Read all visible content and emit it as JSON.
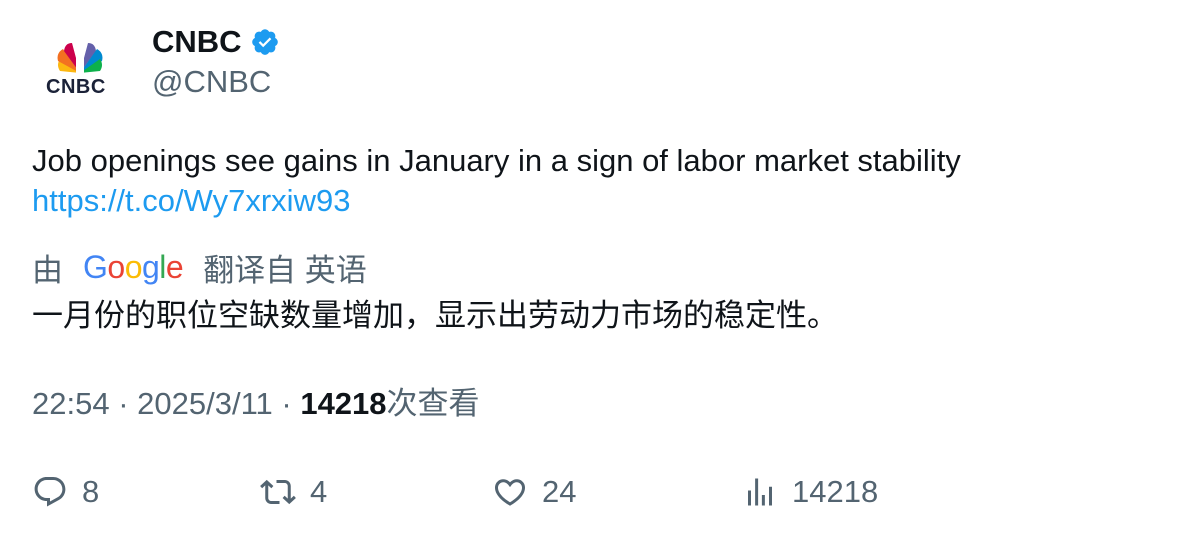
{
  "author": {
    "display_name": "CNBC",
    "handle": "@CNBC",
    "avatar_logo_text": "CNBC",
    "verified_icon": "verified-badge-icon",
    "verified_color": "#1d9bf0"
  },
  "tweet": {
    "text": "Job openings see gains in January in a sign of labor market stability",
    "link": "https://t.co/Wy7xrxiw93",
    "link_color": "#1d9bf0"
  },
  "translation": {
    "by_label": "由",
    "provider": "Google",
    "translated_from_label": "翻译自 英语",
    "text": "一月份的职位空缺数量增加，显示出劳动力市场的稳定性。"
  },
  "meta": {
    "time": "22:54",
    "separator": "·",
    "date": "2025/3/11",
    "views_count": "14218",
    "views_label": "次查看"
  },
  "actions": {
    "reply": {
      "icon": "reply-icon",
      "count": "8"
    },
    "retweet": {
      "icon": "retweet-icon",
      "count": "4"
    },
    "like": {
      "icon": "heart-icon",
      "count": "24"
    },
    "views": {
      "icon": "analytics-icon",
      "count": "14218"
    }
  },
  "colors": {
    "text_primary": "#0f1419",
    "text_secondary": "#536471",
    "accent": "#1d9bf0"
  }
}
